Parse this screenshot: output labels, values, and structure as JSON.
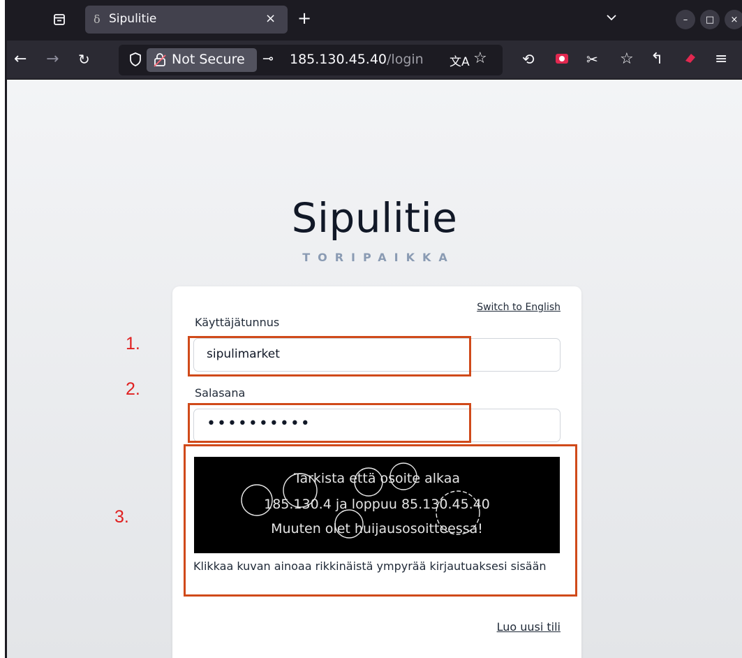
{
  "browser": {
    "tab_title": "Sipulitie",
    "tab_close": "×",
    "new_tab": "+",
    "not_secure_label": "Not Secure",
    "url_host": "185.130.45.40",
    "url_path": "/login"
  },
  "page": {
    "brand_title": "Sipulitie",
    "brand_subtitle": "TORIPAIKKA",
    "switch_language": "Switch to English",
    "username_label": "Käyttäjätunnus",
    "username_value": "sipulimarket",
    "password_label": "Salasana",
    "password_mask": "••••••••••",
    "captcha_lines": [
      "Tarkista että osoite alkaa",
      "185.130.4 ja loppuu 85.130.45.40",
      "Muuten olet huijausosoitteessa!"
    ],
    "captcha_instruction": "Klikkaa kuvan ainoaa rikkinäistä ympyrää kirjautuaksesi sisään",
    "create_account": "Luo uusi tili"
  },
  "annotations": [
    "1.",
    "2.",
    "3."
  ],
  "colors": {
    "annotation_box": "#d04a1a",
    "annotation_number": "#e02020",
    "browser_chrome": "#2b2a33",
    "brand_text": "#111827",
    "brand_subtitle": "#8a9bb3"
  }
}
